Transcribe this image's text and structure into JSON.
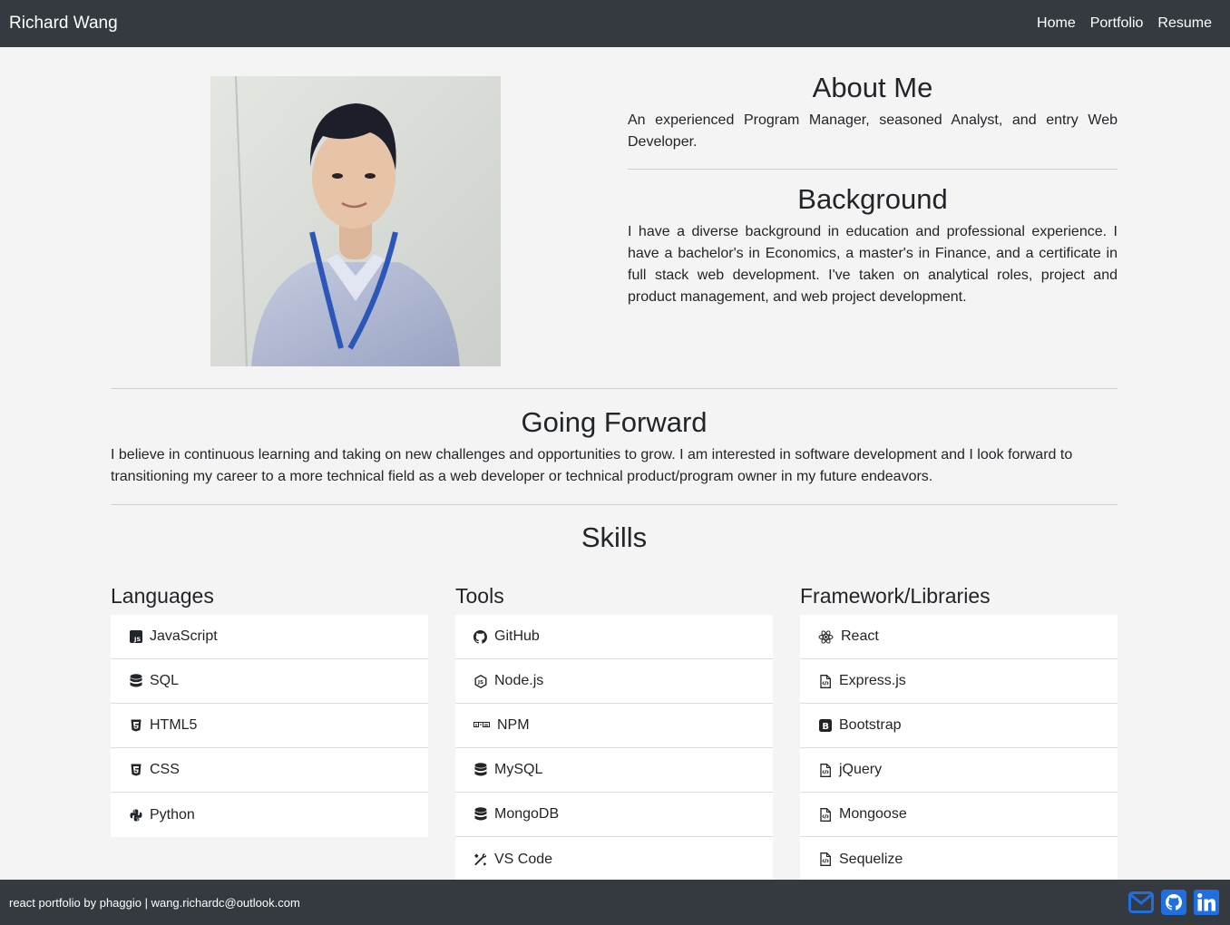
{
  "nav": {
    "brand": "Richard Wang",
    "links": [
      "Home",
      "Portfolio",
      "Resume"
    ]
  },
  "about": {
    "title": "About Me",
    "text": "An experienced Program Manager, seasoned Analyst, and entry Web Developer."
  },
  "background": {
    "title": "Background",
    "text": "I have a diverse background in education and professional experience. I have a bachelor's in Economics, a master's in Finance, and a certificate in full stack web development. I've taken on analytical roles, project and product management, and web project development."
  },
  "forward": {
    "title": "Going Forward",
    "text": "I believe in continuous learning and taking on new challenges and opportunities to grow. I am interested in software development and I look forward to transitioning my career to a more technical field as a web developer or technical product/program owner in my future endeavors."
  },
  "skills": {
    "title": "Skills",
    "columns": [
      {
        "title": "Languages",
        "items": [
          {
            "label": "JavaScript",
            "icon": "js-square-icon"
          },
          {
            "label": "SQL",
            "icon": "database-icon"
          },
          {
            "label": "HTML5",
            "icon": "html5-icon"
          },
          {
            "label": "CSS",
            "icon": "css3-icon"
          },
          {
            "label": "Python",
            "icon": "python-icon"
          }
        ]
      },
      {
        "title": "Tools",
        "items": [
          {
            "label": "GitHub",
            "icon": "github-icon"
          },
          {
            "label": "Node.js",
            "icon": "nodejs-icon"
          },
          {
            "label": "NPM",
            "icon": "npm-icon"
          },
          {
            "label": "MySQL",
            "icon": "database-icon"
          },
          {
            "label": "MongoDB",
            "icon": "database-icon"
          },
          {
            "label": "VS Code",
            "icon": "tools-icon"
          }
        ]
      },
      {
        "title": "Framework/Libraries",
        "items": [
          {
            "label": "React",
            "icon": "react-icon"
          },
          {
            "label": "Express.js",
            "icon": "file-code-icon"
          },
          {
            "label": "Bootstrap",
            "icon": "bootstrap-icon"
          },
          {
            "label": "jQuery",
            "icon": "file-code-icon"
          },
          {
            "label": "Mongoose",
            "icon": "file-code-icon"
          },
          {
            "label": "Sequelize",
            "icon": "file-code-icon"
          }
        ]
      }
    ]
  },
  "footer": {
    "text": "react portfolio by phaggio | wang.richardc@outlook.com",
    "social": [
      "envelope-icon",
      "github-icon",
      "linkedin-icon"
    ]
  },
  "colors": {
    "navbar": "#343a40",
    "page_bg": "#f4f4f4",
    "social_icon": "#1f6fe0"
  }
}
